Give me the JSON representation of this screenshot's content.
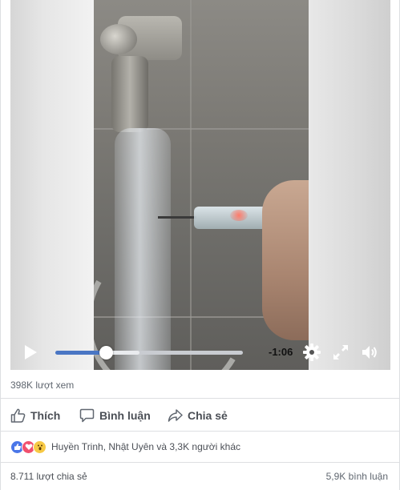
{
  "video": {
    "time_remaining": "-1:06",
    "progress": 0.27,
    "buffered": 0.45,
    "icons": {
      "play": "play-icon",
      "settings": "gear-icon",
      "fullscreen": "fullscreen-icon",
      "volume": "volume-icon"
    }
  },
  "stats": {
    "views": "398K lượt xem",
    "shares": "8.711 lượt chia sẻ",
    "comments": "5,9K bình luận"
  },
  "actions": {
    "like": "Thích",
    "comment": "Bình luận",
    "share": "Chia sẻ"
  },
  "reactions": {
    "summary": "Huyền Trinh, Nhật Uyên và 3,3K người khác",
    "types": [
      "like-icon",
      "love-icon",
      "wow-icon"
    ]
  },
  "colors": {
    "progress": "#4a76c4",
    "text_secondary": "#606770",
    "action_text": "#4b4f56"
  }
}
